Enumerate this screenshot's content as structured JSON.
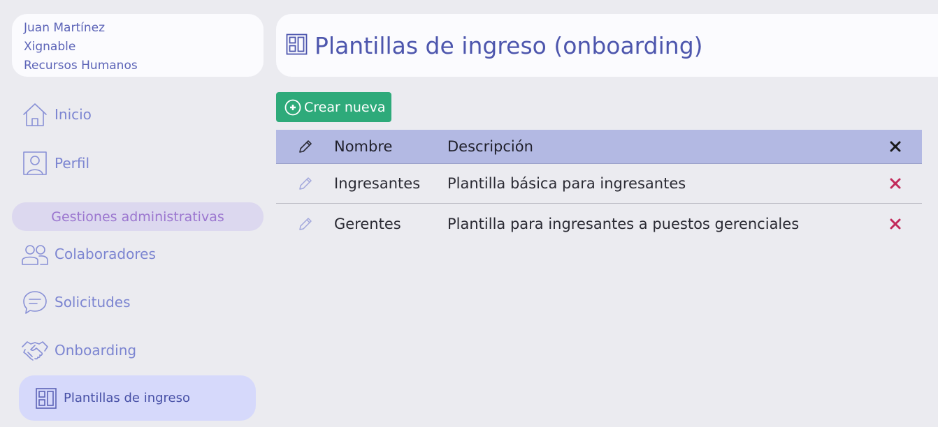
{
  "user": {
    "name": "Juan Martínez",
    "company": "Xignable",
    "department": "Recursos Humanos"
  },
  "sidebar": {
    "items": [
      {
        "label": "Inicio",
        "icon": "home-icon"
      },
      {
        "label": "Perfil",
        "icon": "profile-icon"
      }
    ],
    "section_label": "Gestiones administrativas",
    "section_items": [
      {
        "label": "Colaboradores",
        "icon": "users-icon"
      },
      {
        "label": "Solicitudes",
        "icon": "chat-icon"
      },
      {
        "label": "Onboarding",
        "icon": "handshake-icon"
      }
    ],
    "active_item": {
      "label": "Plantillas de ingreso",
      "icon": "template-icon"
    }
  },
  "header": {
    "title": "Plantillas de ingreso (onboarding)",
    "icon": "template-icon"
  },
  "toolbar": {
    "create_label": "Crear nueva",
    "create_color": "#2eaa7a"
  },
  "table": {
    "columns": [
      "Nombre",
      "Descripción"
    ],
    "rows": [
      {
        "name": "Ingresantes",
        "description": "Plantilla básica para ingresantes"
      },
      {
        "name": "Gerentes",
        "description": "Plantilla para ingresantes a puestos gerenciales"
      }
    ],
    "header_color": "#b3b9e3",
    "delete_color": "#c22a5a"
  }
}
